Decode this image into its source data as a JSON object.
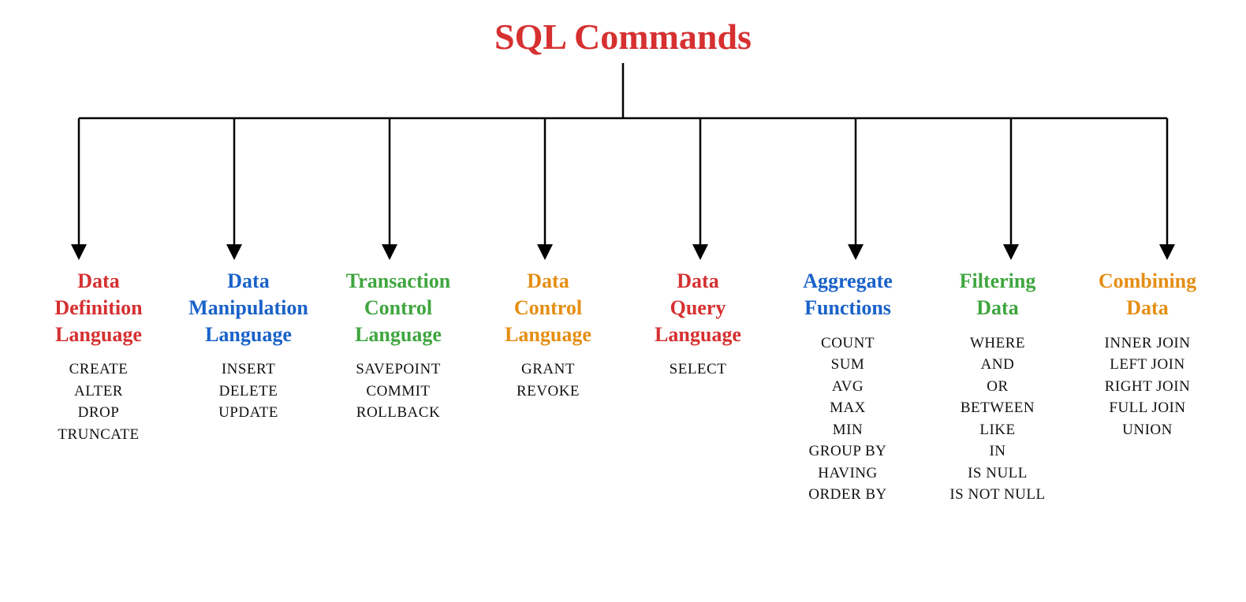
{
  "title": "SQL Commands",
  "categories": [
    {
      "colorClass": "c-red",
      "lines": [
        "Data",
        "Definition",
        "Language"
      ],
      "commands": [
        "CREATE",
        "ALTER",
        "DROP",
        "TRUNCATE"
      ]
    },
    {
      "colorClass": "c-blue",
      "lines": [
        "Data",
        "Manipulation",
        "Language"
      ],
      "commands": [
        "INSERT",
        "DELETE",
        "UPDATE"
      ]
    },
    {
      "colorClass": "c-green",
      "lines": [
        "Transaction",
        "Control",
        "Language"
      ],
      "commands": [
        "SAVEPOINT",
        "COMMIT",
        "ROLLBACK"
      ]
    },
    {
      "colorClass": "c-orange",
      "lines": [
        "Data",
        "Control",
        "Language"
      ],
      "commands": [
        "GRANT",
        "REVOKE"
      ]
    },
    {
      "colorClass": "c-red",
      "lines": [
        "Data",
        "Query",
        "Language"
      ],
      "commands": [
        "SELECT"
      ]
    },
    {
      "colorClass": "c-blue",
      "lines": [
        "Aggregate",
        "Functions"
      ],
      "commands": [
        "COUNT",
        "SUM",
        "AVG",
        "MAX",
        "MIN",
        "GROUP BY",
        "HAVING",
        "ORDER BY"
      ]
    },
    {
      "colorClass": "c-green",
      "lines": [
        "Filtering",
        "Data"
      ],
      "commands": [
        "WHERE",
        "AND",
        "OR",
        "BETWEEN",
        "LIKE",
        "IN",
        "IS NULL",
        "IS NOT NULL"
      ]
    },
    {
      "colorClass": "c-orange",
      "lines": [
        "Combining",
        "Data"
      ],
      "commands": [
        "INNER JOIN",
        "LEFT JOIN",
        "RIGHT JOIN",
        "FULL JOIN",
        "UNION"
      ]
    }
  ]
}
